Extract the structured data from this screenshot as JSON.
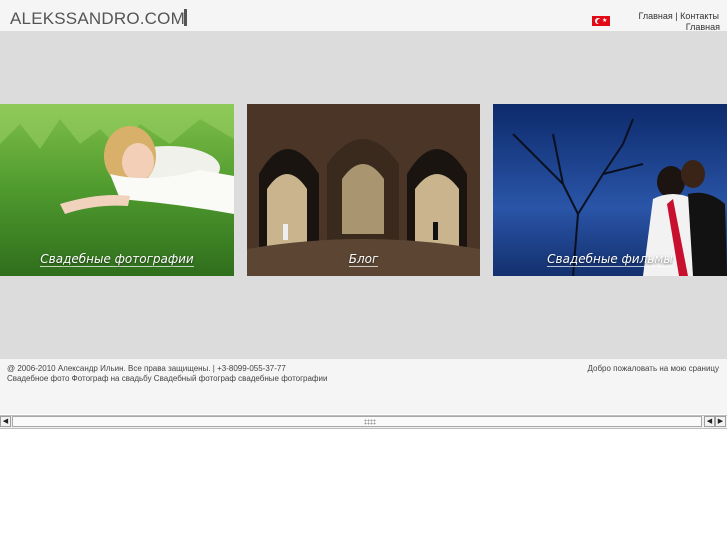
{
  "header": {
    "logo_text": "ALEKSSANDRO.COM",
    "flag_icon": "turkey-flag-icon",
    "nav_home": "Главная",
    "nav_separator": "|",
    "nav_contacts": "Контакты",
    "subnav_home": "Главная"
  },
  "tiles": [
    {
      "label": "Свадебные фотографии",
      "image": "bride-lying-in-grass"
    },
    {
      "label": "Блог",
      "image": "couple-in-stone-archway"
    },
    {
      "label": "Свадебные фильмы",
      "image": "couple-under-night-tree"
    }
  ],
  "footer": {
    "copyright": "@ 2006-2010 Александр Ильин. Все права защищены. | +3-8099-055-37-77",
    "keywords": "Свадебное фото Фотограф на свадьбу Свадебный фотограф свадебные фотографии",
    "welcome": "Добро пожаловать на мою сраницу"
  },
  "colors": {
    "stage_bg": "#dcdcdc",
    "header_bg": "#f5f5f5",
    "flag_red": "#e30a17"
  }
}
